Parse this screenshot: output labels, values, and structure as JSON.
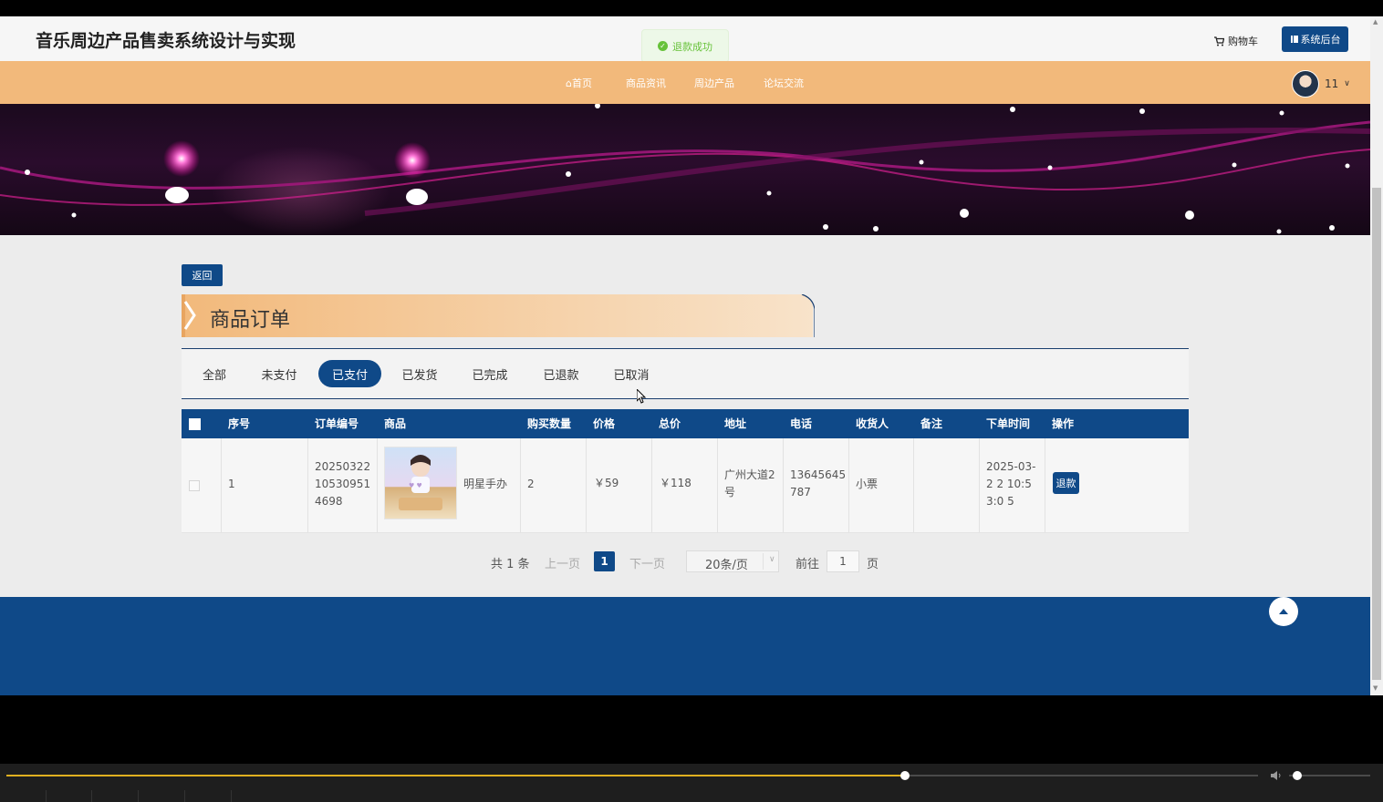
{
  "header": {
    "site_title": "音乐周边产品售卖系统设计与实现",
    "toast": "退款成功",
    "cart_label": "购物车",
    "admin_label": "系统后台",
    "username": "11"
  },
  "nav": {
    "items": [
      {
        "label": "首页",
        "icon": "home-icon"
      },
      {
        "label": "商品资讯"
      },
      {
        "label": "周边产品"
      },
      {
        "label": "论坛交流"
      }
    ]
  },
  "page": {
    "back_label": "返回",
    "section_title": "商品订单",
    "tabs": [
      "全部",
      "未支付",
      "已支付",
      "已发货",
      "已完成",
      "已退款",
      "已取消"
    ],
    "active_tab": "已支付"
  },
  "table": {
    "headers": [
      "序号",
      "订单编号",
      "商品",
      "购买数量",
      "价格",
      "总价",
      "地址",
      "电话",
      "收货人",
      "备注",
      "下单时间",
      "操作"
    ],
    "rows": [
      {
        "index": "1",
        "order_no": "20250322 10530951 4698",
        "product_name": "明星手办",
        "quantity": "2",
        "price": "￥59",
        "total": "￥118",
        "address": "广州大道2 号",
        "phone": "13645645 787",
        "receiver": "小票",
        "remark": "",
        "order_time": "2025-03-2 2 10:53:0 5",
        "action_label": "退款"
      }
    ]
  },
  "pagination": {
    "total_text": "共 1 条",
    "prev_label": "上一页",
    "current_page": "1",
    "next_label": "下一页",
    "page_size": "20条/页",
    "goto_label": "前往",
    "goto_value": "1",
    "page_suffix": "页"
  },
  "player": {
    "progress": 0.718,
    "volume": 0.05
  },
  "colors": {
    "primary": "#0f4988",
    "nav_bg": "#f2b97b",
    "success": "#67c23a"
  }
}
